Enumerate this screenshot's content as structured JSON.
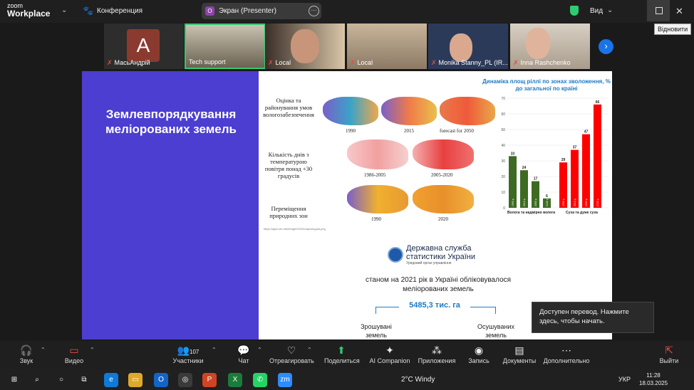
{
  "app": {
    "logo_line1": "zoom",
    "logo_line2": "Workplace",
    "conference": "Конференция",
    "screen_label": "Экран (Presenter)",
    "view": "Вид",
    "restore_tooltip": "Відновити"
  },
  "participants": [
    {
      "name": "МасьАндрій",
      "avatar": "A"
    },
    {
      "name": "Tech support"
    },
    {
      "name": "Local"
    },
    {
      "name": "Local"
    },
    {
      "name": "Monika Stanny_PL (IR..."
    },
    {
      "name": "Inna Rashchenko"
    }
  ],
  "slide": {
    "title": "Землевпорядкування меліорованих земель",
    "label_1": "Оцінка та районування умов вологозабезпечення",
    "label_2": "Кількість днів з температурою повітря понад +30 градусів",
    "label_3": "Переміщення природних зон",
    "years_row1": [
      "1990",
      "2015",
      "forecast for 2050"
    ],
    "years_row2": [
      "1986-2005",
      "2005-2020"
    ],
    "years_row3": [
      "1990",
      "2020"
    ],
    "source": "https://agro.ukr.net/image/2022/mapvologost.png",
    "stat_org": "Державна служба статистики України",
    "stat_sub": "Урядовий орган управління",
    "stat_text": "станом на 2021 рік в Україні обліковувалося меліорованих земель",
    "big_value": "5485,3 тис. га",
    "irrigated": "Зрошувані земель",
    "drained": "Осушуваних земель"
  },
  "chart_data": {
    "type": "bar",
    "title": "Динаміка площ ріллі по зонах зволоження, % до загальної по країні",
    "ylim": [
      0,
      70
    ],
    "yticks": [
      0,
      10,
      20,
      30,
      40,
      50,
      60,
      70
    ],
    "groups": [
      "Волога та надмірно волога",
      "Суха та дуже суха"
    ],
    "series": [
      {
        "name": "Волога та надмірно волога",
        "color": "#3d6b21",
        "categories": [
          "1990 р.",
          "2015 р.",
          "2050 р.",
          "2100 р."
        ],
        "values": [
          33,
          24,
          17,
          6
        ]
      },
      {
        "name": "Суха та дуже суха",
        "color": "#ff0000",
        "categories": [
          "1990 р.",
          "2015 р.",
          "2050 р.",
          "2100 р."
        ],
        "values": [
          29,
          37,
          47,
          66
        ]
      }
    ]
  },
  "translate_tip": "Доступен перевод. Нажмите здесь, чтобы начать.",
  "toolbar": {
    "sound": "Звук",
    "video": "Видео",
    "participants": "Участники",
    "participants_count": "107",
    "chat": "Чат",
    "react": "Отреагировать",
    "share": "Поделиться",
    "ai": "AI Companion",
    "apps": "Приложения",
    "record": "Запись",
    "docs": "Документы",
    "more": "Дополнительно",
    "leave": "Выйти"
  },
  "taskbar": {
    "weather": "2°C  Windy",
    "lang": "УКР",
    "time": "11:28",
    "date": "18.03.2025"
  },
  "colors": {
    "accent": "#1a73e8",
    "slide_left": "#4b3ed1",
    "share_green": "#2ecc71"
  }
}
